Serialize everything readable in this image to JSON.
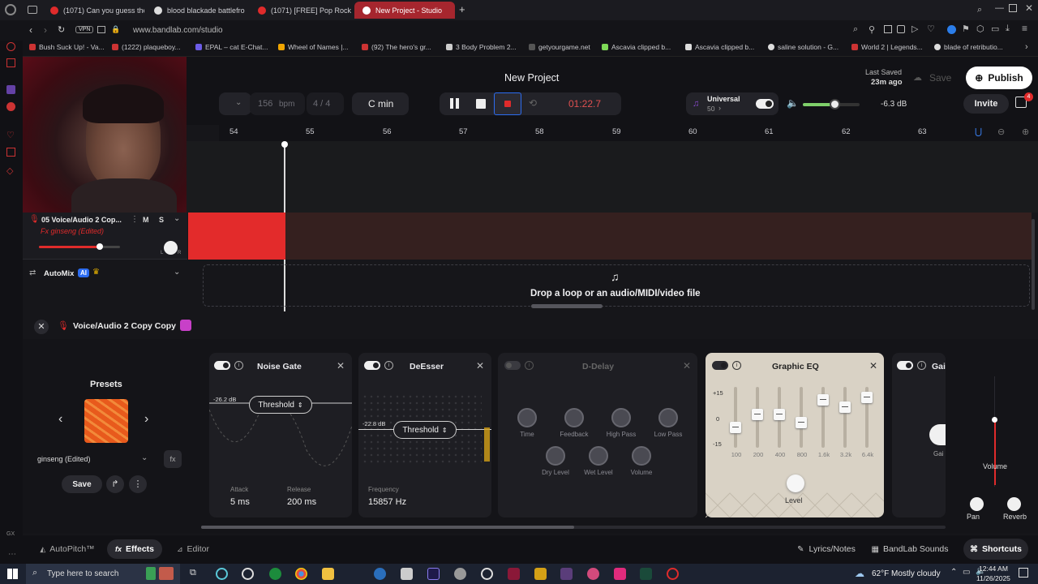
{
  "browser": {
    "tabs": [
      {
        "label": "(1071) Can you guess the"
      },
      {
        "label": "blood blackade battlefro"
      },
      {
        "label": "(1071) [FREE] Pop Rock"
      },
      {
        "label": "New Project - Studio"
      }
    ],
    "new_tab": "+",
    "vpn": "VPN",
    "url": "www.bandlab.com/studio",
    "bookmarks": [
      "Bush Suck Up! - Va...",
      "(1222) plaqueboy...",
      "EPAL – cat E-Chat...",
      "Wheel of Names |...",
      "(92) The hero's gr...",
      "3 Body Problem 2...",
      "getyourgame.net",
      "Ascavia clipped b...",
      "Ascavia clipped b...",
      "saline solution - G...",
      "World 2 | Legends...",
      "blade of retributio..."
    ]
  },
  "studio": {
    "project_title": "New Project",
    "last_saved_label": "Last Saved",
    "last_saved_ago": "23m ago",
    "save_label": "Save",
    "publish_label": "Publish",
    "invite_label": "Invite",
    "gift_badge": "4",
    "bpm_value": "156",
    "bpm_unit": "bpm",
    "time_sig": "4 / 4",
    "key": "C min",
    "time_display": "01:22.7",
    "universal_label": "Universal",
    "universal_value": "50",
    "master_volume_level": 0.55,
    "master_db": "-6.3 dB",
    "ruler": [
      "54",
      "55",
      "56",
      "57",
      "58",
      "59",
      "60",
      "61",
      "62",
      "63"
    ]
  },
  "track": {
    "name": "05  Voice/Audio 2 Cop...",
    "mute": "M",
    "solo": "S",
    "fx_label": "Fx ginseng (Edited)",
    "pan_l": "L",
    "pan_r": "R",
    "volume_level": 0.75
  },
  "automix": {
    "label": "AutoMix",
    "ai_badge": "AI"
  },
  "dropzone": {
    "text": "Drop a loop or an audio/MIDI/video file"
  },
  "fx": {
    "track_title": "Voice/Audio 2 Copy Copy",
    "presets_title": "Presets",
    "preset_name": "ginseng (Edited)",
    "save_label": "Save",
    "noise_gate": {
      "title": "Noise Gate",
      "db": "-26.2 dB",
      "param": "Threshold",
      "attack_label": "Attack",
      "attack_value": "5 ms",
      "release_label": "Release",
      "release_value": "200 ms"
    },
    "deesser": {
      "title": "DeEsser",
      "db": "-22.8 dB",
      "param": "Threshold",
      "freq_label": "Frequency",
      "freq_value": "15857 Hz"
    },
    "ddelay": {
      "title": "D-Delay",
      "knobs": [
        "Time",
        "Feedback",
        "High Pass",
        "Low Pass",
        "Dry Level",
        "Wet Level",
        "Volume"
      ]
    },
    "geq": {
      "title": "Graphic EQ",
      "scale": [
        "+15",
        "0",
        "-15"
      ],
      "bands": [
        "100",
        "200",
        "400",
        "800",
        "1.6k",
        "3.2k",
        "6.4k"
      ],
      "band_levels": [
        0.3,
        0.55,
        0.55,
        0.4,
        0.85,
        0.7,
        0.9
      ],
      "level_label": "Level"
    },
    "gain_title": "Gai",
    "gain_knob_label": "Gai",
    "volume_label": "Volume",
    "pan_label": "Pan",
    "reverb_label": "Reverb"
  },
  "bottom": {
    "autopitch": "AutoPitch™",
    "effects": "Effects",
    "editor": "Editor",
    "lyrics": "Lyrics/Notes",
    "sounds": "BandLab Sounds",
    "shortcuts": "Shortcuts"
  },
  "taskbar": {
    "search": "Type here to search",
    "weather": "62°F  Mostly cloudy",
    "time": "12:44 AM",
    "date": "11/26/2025"
  }
}
